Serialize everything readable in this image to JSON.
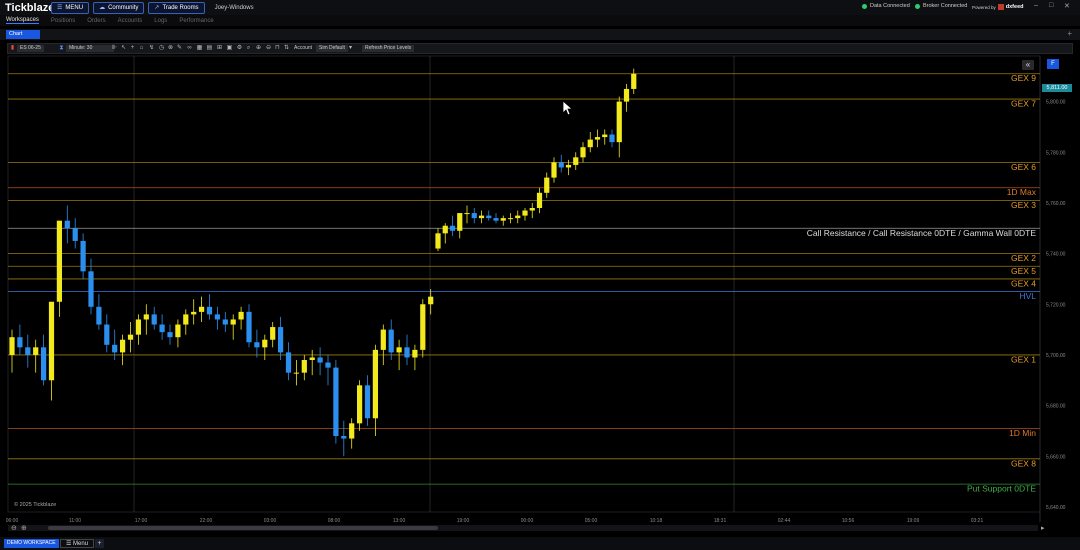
{
  "app": {
    "brand": "Tickblaze",
    "menu_label": "MENU",
    "community_label": "Community",
    "trade_rooms_label": "Trade Rooms",
    "account_name": "Joey-Windows",
    "data_status": "Data Connected",
    "broker_status": "Broker Connected",
    "powered_by": "Powered by",
    "data_provider": "dxfeed"
  },
  "nav": [
    "Workspaces",
    "Positions",
    "Orders",
    "Accounts",
    "Logs",
    "Performance"
  ],
  "tab": {
    "label": "Chart"
  },
  "toolbar": {
    "symbol": "ES 06-25",
    "timeframe": "Minute: 30",
    "account_label": "Account",
    "account_value": "Sim Default",
    "refresh_label": "Refresh Price Levels"
  },
  "footer": {
    "workspace_label": "DEMO WORKSPACE",
    "menu_label": "Menu",
    "add_label": "+",
    "copyright": "© 2025 Tickblaze"
  },
  "colors": {
    "up_candle": "#f2ea1c",
    "down_candle": "#2b8ff0",
    "gex_line": "#9a7a10",
    "gex_label": "#e49b2b",
    "hvl": "#3c78d8",
    "put_support": "#2e8b3a",
    "call_resistance": "#dddddd",
    "accent": "#1a57e0"
  },
  "chart_data": {
    "type": "candlestick",
    "symbol": "ES 06-25",
    "y_range": [
      5638,
      5818
    ],
    "y_ticks": [
      "5,800.00",
      "5,780.00",
      "5,760.00",
      "5,740.00",
      "5,720.00",
      "5,700.00",
      "5,680.00",
      "5,660.00",
      "5,640.00"
    ],
    "last_price": "5,811.00",
    "x_ticks": [
      "06:00",
      "11:00",
      "17:00",
      "22:00",
      "03:00",
      "08:00",
      "13:00",
      "19:00",
      "00:00",
      "05:00",
      "10:18",
      "18:31",
      "02:44",
      "10:56",
      "19:09",
      "03:21"
    ],
    "levels": [
      {
        "label": "GEX 9",
        "price": 5811,
        "kind": "gex"
      },
      {
        "label": "GEX 7",
        "price": 5801,
        "kind": "gex"
      },
      {
        "label": "GEX 6",
        "price": 5776,
        "kind": "gex"
      },
      {
        "label": "1D Max",
        "price": 5766,
        "kind": "dmax"
      },
      {
        "label": "GEX 3",
        "price": 5761,
        "kind": "gex"
      },
      {
        "label": "Call Resistance / Call Resistance 0DTE / Gamma Wall 0DTE",
        "price": 5750,
        "kind": "call"
      },
      {
        "label": "GEX 2",
        "price": 5740,
        "kind": "gex"
      },
      {
        "label": "GEX 5",
        "price": 5735,
        "kind": "gex"
      },
      {
        "label": "GEX 4",
        "price": 5730,
        "kind": "gex"
      },
      {
        "label": "HVL",
        "price": 5725,
        "kind": "hvl"
      },
      {
        "label": "GEX 1",
        "price": 5700,
        "kind": "gex"
      },
      {
        "label": "1D Min",
        "price": 5671,
        "kind": "dmin"
      },
      {
        "label": "GEX 8",
        "price": 5659,
        "kind": "gex"
      },
      {
        "label": "Put Support 0DTE",
        "price": 5649,
        "kind": "put"
      }
    ],
    "candles": [
      [
        5700,
        5710,
        5693,
        5707
      ],
      [
        5707,
        5712,
        5700,
        5703
      ],
      [
        5703,
        5708,
        5695,
        5700
      ],
      [
        5700,
        5706,
        5693,
        5703
      ],
      [
        5703,
        5708,
        5688,
        5690
      ],
      [
        5690,
        5698,
        5682,
        5721
      ],
      [
        5721,
        5752,
        5715,
        5753
      ],
      [
        5753,
        5759,
        5744,
        5750
      ],
      [
        5750,
        5754,
        5742,
        5745
      ],
      [
        5745,
        5748,
        5730,
        5733
      ],
      [
        5733,
        5738,
        5716,
        5719
      ],
      [
        5719,
        5724,
        5710,
        5712
      ],
      [
        5712,
        5716,
        5701,
        5704
      ],
      [
        5704,
        5710,
        5698,
        5701
      ],
      [
        5701,
        5708,
        5696,
        5706
      ],
      [
        5706,
        5713,
        5701,
        5708
      ],
      [
        5708,
        5716,
        5704,
        5714
      ],
      [
        5714,
        5720,
        5708,
        5716
      ],
      [
        5716,
        5719,
        5710,
        5712
      ],
      [
        5712,
        5716,
        5706,
        5709
      ],
      [
        5709,
        5712,
        5704,
        5707
      ],
      [
        5707,
        5714,
        5703,
        5712
      ],
      [
        5712,
        5718,
        5708,
        5716
      ],
      [
        5716,
        5722,
        5712,
        5717
      ],
      [
        5717,
        5723,
        5713,
        5719
      ],
      [
        5719,
        5724,
        5714,
        5716
      ],
      [
        5716,
        5719,
        5710,
        5714
      ],
      [
        5714,
        5717,
        5709,
        5712
      ],
      [
        5712,
        5716,
        5706,
        5714
      ],
      [
        5714,
        5719,
        5710,
        5717
      ],
      [
        5717,
        5720,
        5703,
        5705
      ],
      [
        5705,
        5710,
        5699,
        5703
      ],
      [
        5703,
        5708,
        5698,
        5706
      ],
      [
        5706,
        5713,
        5703,
        5711
      ],
      [
        5711,
        5715,
        5698,
        5701
      ],
      [
        5701,
        5705,
        5690,
        5693
      ],
      [
        5693,
        5698,
        5688,
        5693
      ],
      [
        5693,
        5700,
        5690,
        5698
      ],
      [
        5698,
        5702,
        5692,
        5699
      ],
      [
        5699,
        5703,
        5692,
        5697
      ],
      [
        5697,
        5700,
        5688,
        5695
      ],
      [
        5695,
        5698,
        5665,
        5668
      ],
      [
        5668,
        5674,
        5660,
        5667
      ],
      [
        5667,
        5675,
        5663,
        5673
      ],
      [
        5673,
        5690,
        5670,
        5688
      ],
      [
        5688,
        5692,
        5672,
        5675
      ],
      [
        5675,
        5704,
        5668,
        5702
      ],
      [
        5702,
        5712,
        5696,
        5710
      ],
      [
        5710,
        5714,
        5698,
        5701
      ],
      [
        5701,
        5706,
        5694,
        5703
      ],
      [
        5703,
        5708,
        5696,
        5699
      ],
      [
        5699,
        5704,
        5694,
        5702
      ],
      [
        5702,
        5722,
        5699,
        5720
      ],
      [
        5720,
        5726,
        5716,
        5723
      ],
      [
        5742,
        5750,
        5741,
        5748
      ],
      [
        5748,
        5752,
        5744,
        5751
      ],
      [
        5751,
        5755,
        5747,
        5749
      ],
      [
        5749,
        5755,
        5746,
        5756
      ],
      [
        5756,
        5759,
        5752,
        5756
      ],
      [
        5756,
        5758,
        5752,
        5754
      ],
      [
        5754,
        5757,
        5752,
        5755
      ],
      [
        5755,
        5757,
        5753,
        5754
      ],
      [
        5754,
        5756,
        5752,
        5753
      ],
      [
        5753,
        5755,
        5751,
        5754
      ],
      [
        5754,
        5756,
        5752,
        5754
      ],
      [
        5754,
        5757,
        5752,
        5755
      ],
      [
        5755,
        5758,
        5753,
        5757
      ],
      [
        5757,
        5760,
        5754,
        5758
      ],
      [
        5758,
        5766,
        5756,
        5764
      ],
      [
        5764,
        5772,
        5762,
        5770
      ],
      [
        5770,
        5778,
        5768,
        5776
      ],
      [
        5776,
        5779,
        5772,
        5774
      ],
      [
        5774,
        5777,
        5771,
        5775
      ],
      [
        5775,
        5780,
        5773,
        5778
      ],
      [
        5778,
        5784,
        5776,
        5782
      ],
      [
        5782,
        5788,
        5780,
        5785
      ],
      [
        5785,
        5789,
        5782,
        5786
      ],
      [
        5786,
        5789,
        5783,
        5787
      ],
      [
        5787,
        5789,
        5782,
        5784
      ],
      [
        5784,
        5802,
        5778,
        5800
      ],
      [
        5800,
        5807,
        5796,
        5805
      ],
      [
        5805,
        5813,
        5803,
        5811
      ]
    ]
  }
}
